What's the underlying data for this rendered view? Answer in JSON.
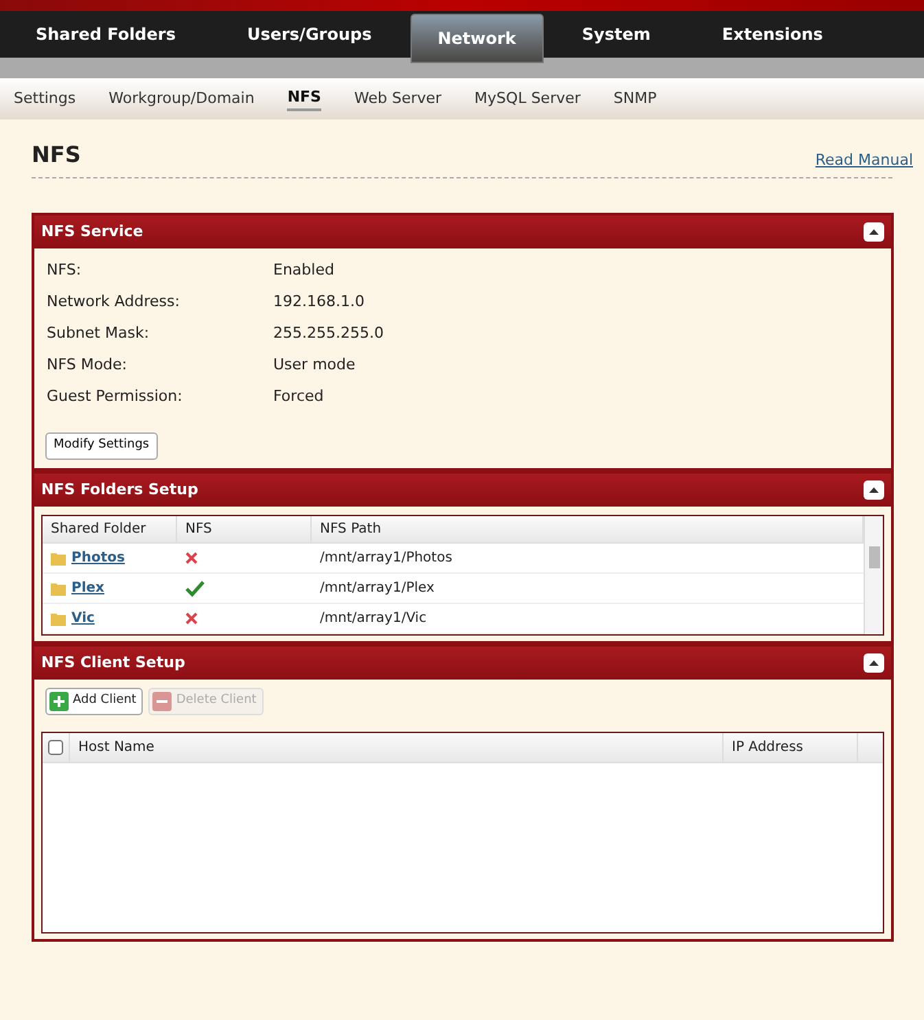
{
  "main_tabs": [
    {
      "label": "Shared Folders",
      "selected": false
    },
    {
      "label": "Users/Groups",
      "selected": false
    },
    {
      "label": "Network",
      "selected": true
    },
    {
      "label": "System",
      "selected": false
    },
    {
      "label": "Extensions",
      "selected": false
    }
  ],
  "sub_tabs": [
    {
      "label": "Settings",
      "selected": false
    },
    {
      "label": "Workgroup/Domain",
      "selected": false
    },
    {
      "label": "NFS",
      "selected": true
    },
    {
      "label": "Web Server",
      "selected": false
    },
    {
      "label": "MySQL Server",
      "selected": false
    },
    {
      "label": "SNMP",
      "selected": false
    }
  ],
  "page_title": "NFS",
  "manual_link": "Read Manual",
  "service": {
    "title": "NFS Service",
    "fields": [
      {
        "label": "NFS:",
        "value": "Enabled"
      },
      {
        "label": "Network Address:",
        "value": "192.168.1.0"
      },
      {
        "label": "Subnet Mask:",
        "value": "255.255.255.0"
      },
      {
        "label": "NFS Mode:",
        "value": "User mode"
      },
      {
        "label": "Guest Permission:",
        "value": "Forced"
      }
    ],
    "button": "Modify Settings"
  },
  "folders": {
    "title": "NFS Folders Setup",
    "columns": [
      "Shared Folder",
      "NFS",
      "NFS Path"
    ],
    "rows": [
      {
        "folder": "Photos",
        "nfs": false,
        "path": "/mnt/array1/Photos"
      },
      {
        "folder": "Plex",
        "nfs": true,
        "path": "/mnt/array1/Plex"
      },
      {
        "folder": "Vic",
        "nfs": false,
        "path": "/mnt/array1/Vic"
      }
    ]
  },
  "clients": {
    "title": "NFS Client Setup",
    "buttons": [
      {
        "label": "Add Client",
        "disabled": false,
        "kind": "add"
      },
      {
        "label": "Delete Client",
        "disabled": true,
        "kind": "delete"
      }
    ],
    "select_all_checked": false,
    "columns": [
      "Host Name",
      "IP Address"
    ]
  }
}
